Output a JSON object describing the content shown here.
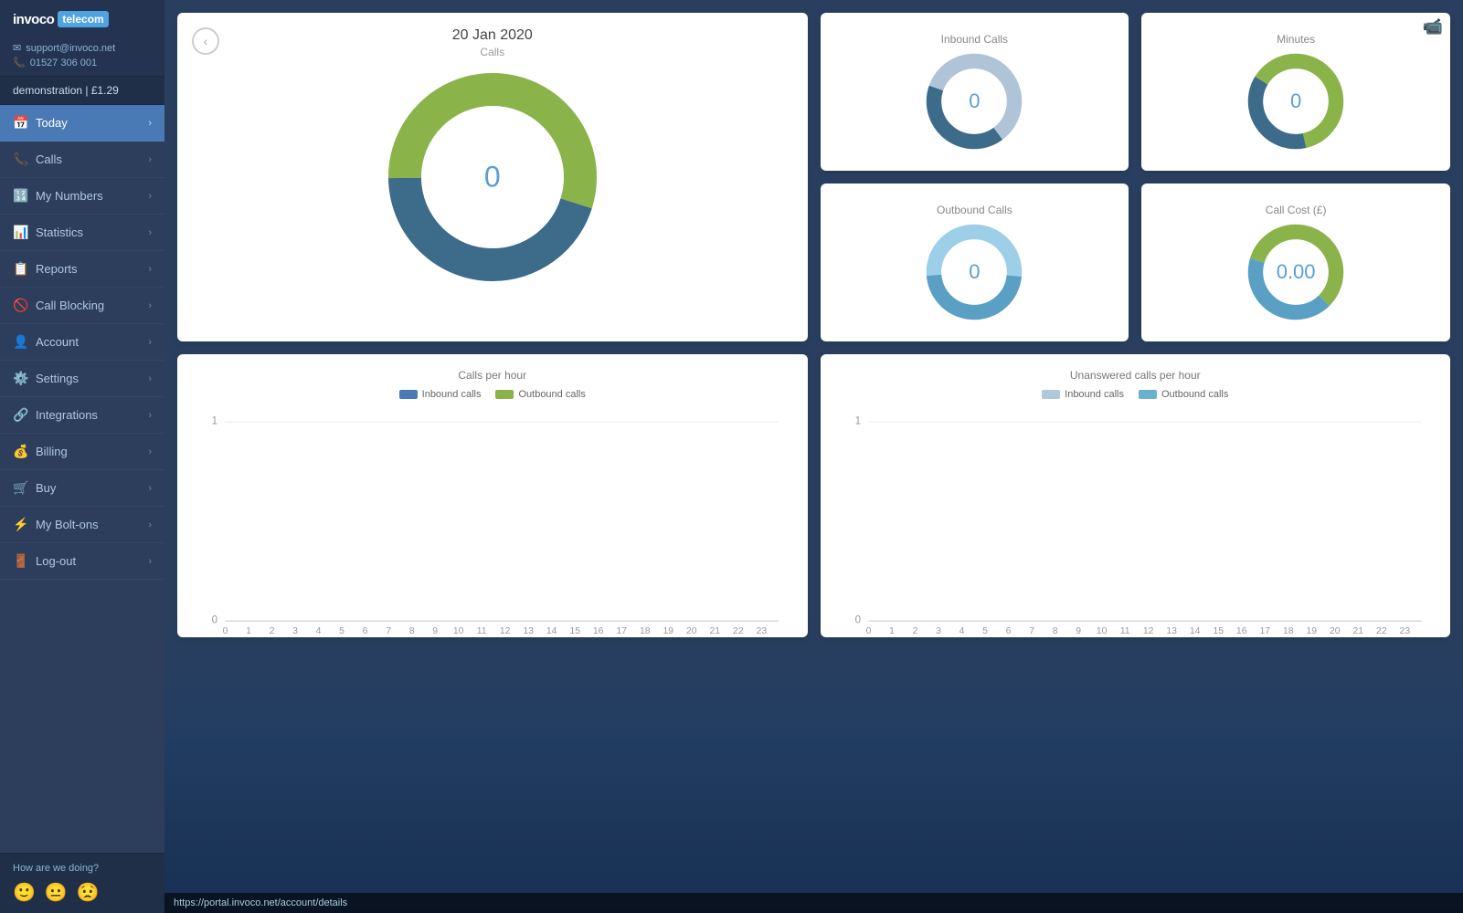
{
  "app": {
    "logo_invoco": "invoco",
    "logo_telecom": "telecom",
    "support_email": "support@invoco.net",
    "support_phone": "01527 306 001",
    "account_name": "demonstration | £1.29",
    "video_icon": "📹"
  },
  "sidebar": {
    "items": [
      {
        "id": "today",
        "label": "Today",
        "icon": "📅",
        "active": true
      },
      {
        "id": "calls",
        "label": "Calls",
        "icon": "📞",
        "active": false
      },
      {
        "id": "my-numbers",
        "label": "My Numbers",
        "icon": "🔢",
        "active": false
      },
      {
        "id": "statistics",
        "label": "Statistics",
        "icon": "📊",
        "active": false
      },
      {
        "id": "reports",
        "label": "Reports",
        "icon": "📋",
        "active": false
      },
      {
        "id": "call-blocking",
        "label": "Call Blocking",
        "icon": "🚫",
        "active": false
      },
      {
        "id": "account",
        "label": "Account",
        "icon": "👤",
        "active": false
      },
      {
        "id": "settings",
        "label": "Settings",
        "icon": "⚙️",
        "active": false
      },
      {
        "id": "integrations",
        "label": "Integrations",
        "icon": "🔗",
        "active": false
      },
      {
        "id": "billing",
        "label": "Billing",
        "icon": "💰",
        "active": false
      },
      {
        "id": "buy",
        "label": "Buy",
        "icon": "🛒",
        "active": false
      },
      {
        "id": "my-bolt-ons",
        "label": "My Bolt-ons",
        "icon": "⚡",
        "active": false
      },
      {
        "id": "log-out",
        "label": "Log-out",
        "icon": "🚪",
        "active": false
      }
    ],
    "how_are_we": "How are we doing?"
  },
  "main_chart": {
    "date": "20 Jan 2020",
    "subtitle": "Calls",
    "center_value": "0",
    "back_label": "‹"
  },
  "stat_cards": [
    {
      "id": "inbound-calls",
      "title": "Inbound Calls",
      "value": "0",
      "color_left": "#b0c4d8",
      "color_right": "#3d6b8a"
    },
    {
      "id": "minutes",
      "title": "Minutes",
      "value": "0",
      "color_left": "#8ab34a",
      "color_right": "#3d6b8a"
    },
    {
      "id": "outbound-calls",
      "title": "Outbound Calls",
      "value": "0",
      "color_left": "#6ab0d4",
      "color_right": "#8ab8d4"
    },
    {
      "id": "call-cost",
      "title": "Call Cost (£)",
      "value": "0.00",
      "color_left": "#8ab34a",
      "color_right": "#6ab0d4"
    }
  ],
  "calls_per_hour": {
    "title": "Calls per hour",
    "legend_inbound": "Inbound calls",
    "legend_outbound": "Outbound calls",
    "color_inbound": "#4a7ab5",
    "color_outbound": "#8ab34a",
    "y_max": 1,
    "y_min": 0,
    "x_labels": [
      "0",
      "1",
      "2",
      "3",
      "4",
      "5",
      "6",
      "7",
      "8",
      "9",
      "10",
      "11",
      "12",
      "13",
      "14",
      "15",
      "16",
      "17",
      "18",
      "19",
      "20",
      "21",
      "22",
      "23"
    ]
  },
  "unanswered_per_hour": {
    "title": "Unanswered calls per hour",
    "legend_inbound": "Inbound calls",
    "legend_outbound": "Outbound calls",
    "color_inbound": "#b0c8d8",
    "color_outbound": "#6ab0d4",
    "y_max": 1,
    "y_min": 0,
    "x_labels": [
      "0",
      "1",
      "2",
      "3",
      "4",
      "5",
      "6",
      "7",
      "8",
      "9",
      "10",
      "11",
      "12",
      "13",
      "14",
      "15",
      "16",
      "17",
      "18",
      "19",
      "20",
      "21",
      "22",
      "23"
    ]
  },
  "status_bar": {
    "url": "https://portal.invoco.net/account/details"
  }
}
